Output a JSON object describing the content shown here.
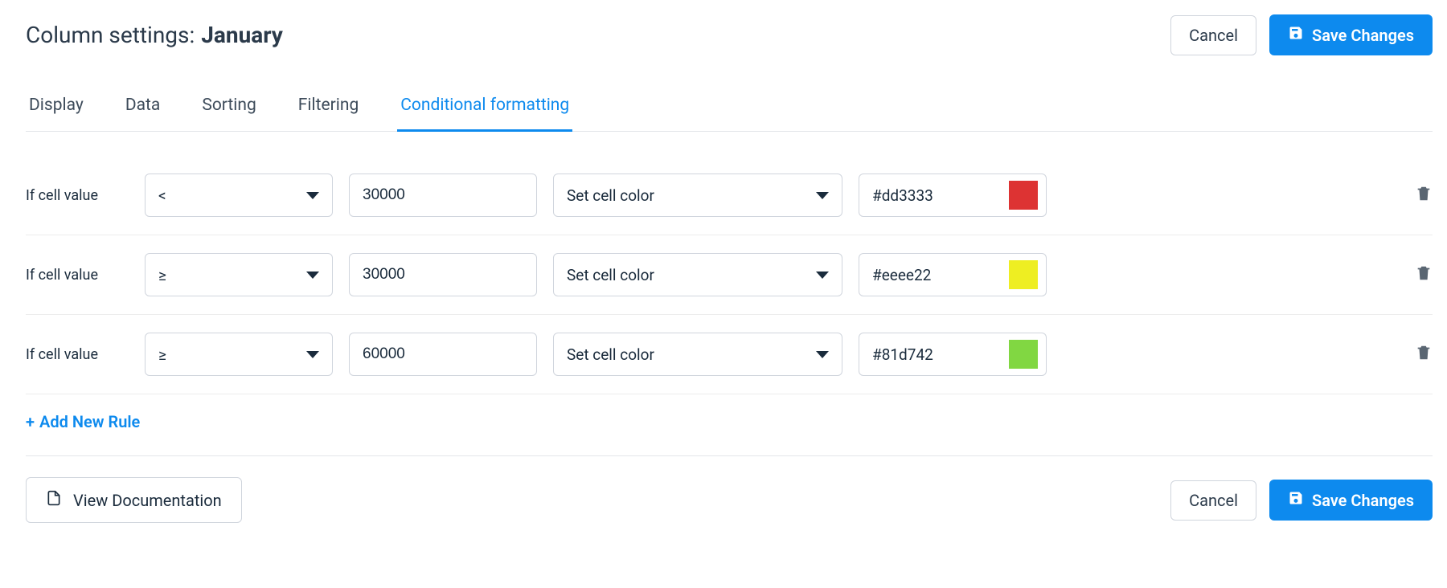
{
  "header": {
    "title_prefix": "Column settings:",
    "column_name": "January",
    "cancel": "Cancel",
    "save": "Save Changes"
  },
  "tabs": {
    "display": "Display",
    "data": "Data",
    "sorting": "Sorting",
    "filtering": "Filtering",
    "conditional": "Conditional formatting"
  },
  "rule_label": "If cell value",
  "rules": [
    {
      "operator": "<",
      "value": "30000",
      "action": "Set cell color",
      "color_hex": "#dd3333",
      "swatch": "#dd3333"
    },
    {
      "operator": "≥",
      "value": "30000",
      "action": "Set cell color",
      "color_hex": "#eeee22",
      "swatch": "#eeee22"
    },
    {
      "operator": "≥",
      "value": "60000",
      "action": "Set cell color",
      "color_hex": "#81d742",
      "swatch": "#81d742"
    }
  ],
  "add_rule": "Add New Rule",
  "footer": {
    "view_docs": "View Documentation",
    "cancel": "Cancel",
    "save": "Save Changes"
  }
}
